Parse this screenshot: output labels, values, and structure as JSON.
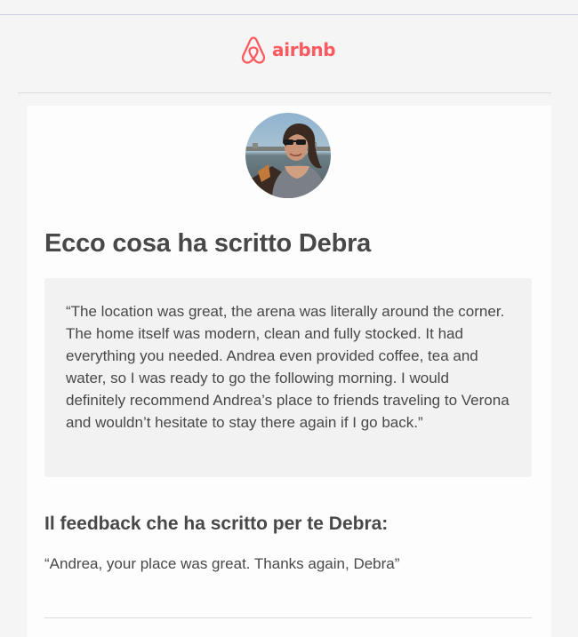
{
  "brand": {
    "logo_text": "airbnb",
    "color": "#ff5a5f",
    "icon": "airbnb-belo-icon"
  },
  "reviewer": {
    "avatar": "reviewer-avatar-photo"
  },
  "review": {
    "title": "Ecco cosa ha scritto Debra",
    "quote": "“The location was great, the arena was literally around the corner. The home itself was modern, clean and fully stocked. It had everything you needed. Andrea even provided coffee, tea and water, so I was ready to go the following morning. I would definitely recommend Andrea’s place to friends traveling to Verona and wouldn’t hesitate to stay there again if I go back.”"
  },
  "feedback": {
    "heading": "Il feedback che ha scritto per te Debra:",
    "text": "“Andrea, your place was great. Thanks again, Debra”"
  }
}
